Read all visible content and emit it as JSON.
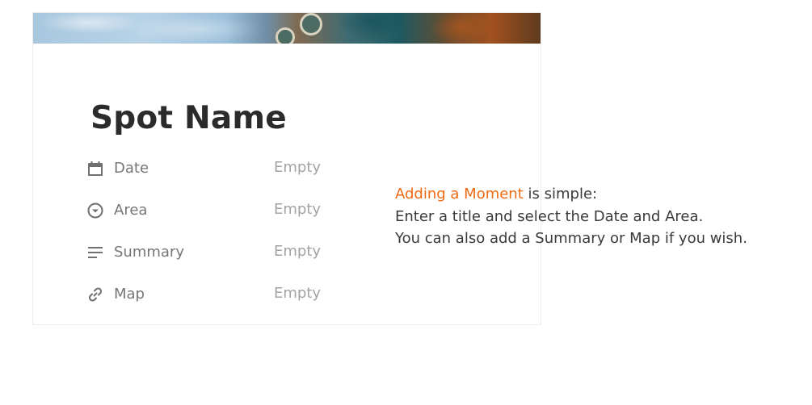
{
  "page": {
    "title": "Spot Name",
    "properties": [
      {
        "icon": "calendar-icon",
        "label": "Date",
        "value": "Empty"
      },
      {
        "icon": "circle-chevron-down-icon",
        "label": "Area",
        "value": "Empty"
      },
      {
        "icon": "text-lines-icon",
        "label": "Summary",
        "value": "Empty"
      },
      {
        "icon": "link-icon",
        "label": "Map",
        "value": "Empty"
      }
    ]
  },
  "caption": {
    "highlight": "Adding a Moment",
    "line1_rest": " is simple:",
    "line2": "Enter a title and select the Date and Area.",
    "line3": "You can also add a Summary or Map if you wish."
  },
  "colors": {
    "accent": "#f06a13",
    "title": "#2b2b2b",
    "label": "#767676",
    "empty": "#a3a3a3"
  }
}
